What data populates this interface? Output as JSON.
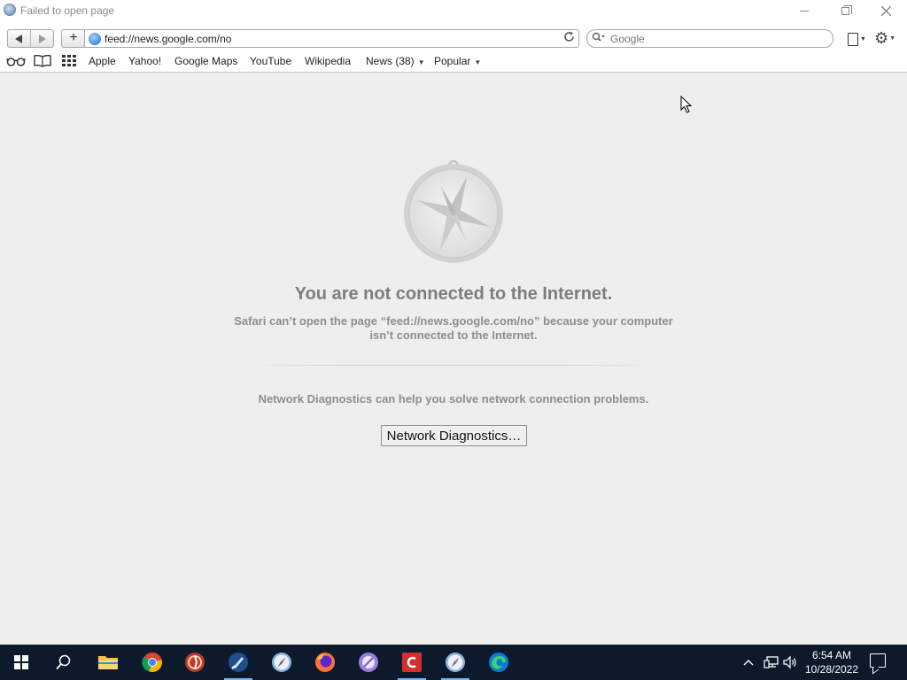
{
  "window": {
    "title": "Failed to open page"
  },
  "toolbar": {
    "add_label": "+",
    "url": "feed://news.google.com/no",
    "search_placeholder": "Google"
  },
  "bookmarks": {
    "items": [
      {
        "label": "Apple"
      },
      {
        "label": "Yahoo!"
      },
      {
        "label": "Google Maps"
      },
      {
        "label": "YouTube"
      },
      {
        "label": "Wikipedia"
      },
      {
        "label": "News (38)",
        "has_menu": true
      },
      {
        "label": "Popular",
        "has_menu": true
      }
    ]
  },
  "error_page": {
    "headline": "You are not connected to the Internet.",
    "message": "Safari can’t open the page “feed://news.google.com/no” because your computer isn’t connected to the Internet.",
    "help_text": "Network Diagnostics can help you solve network connection problems.",
    "button_label": "Network Diagnostics…"
  },
  "taskbar": {
    "apps": [
      {
        "name": "search-icon"
      },
      {
        "name": "file-explorer-icon"
      },
      {
        "name": "chrome-icon"
      },
      {
        "name": "app-red-icon"
      },
      {
        "name": "app-blue-icon"
      },
      {
        "name": "safari-icon"
      },
      {
        "name": "firefox-icon"
      },
      {
        "name": "app-purple-icon"
      },
      {
        "name": "app-red-square-icon"
      },
      {
        "name": "safari-icon-2"
      },
      {
        "name": "edge-icon"
      }
    ],
    "time": "6:54 AM",
    "date": "10/28/2022"
  },
  "colors": {
    "taskbar_bg": "#0c1a2b",
    "page_bg": "#eeeeee",
    "headline_text": "#7d7d7d"
  }
}
